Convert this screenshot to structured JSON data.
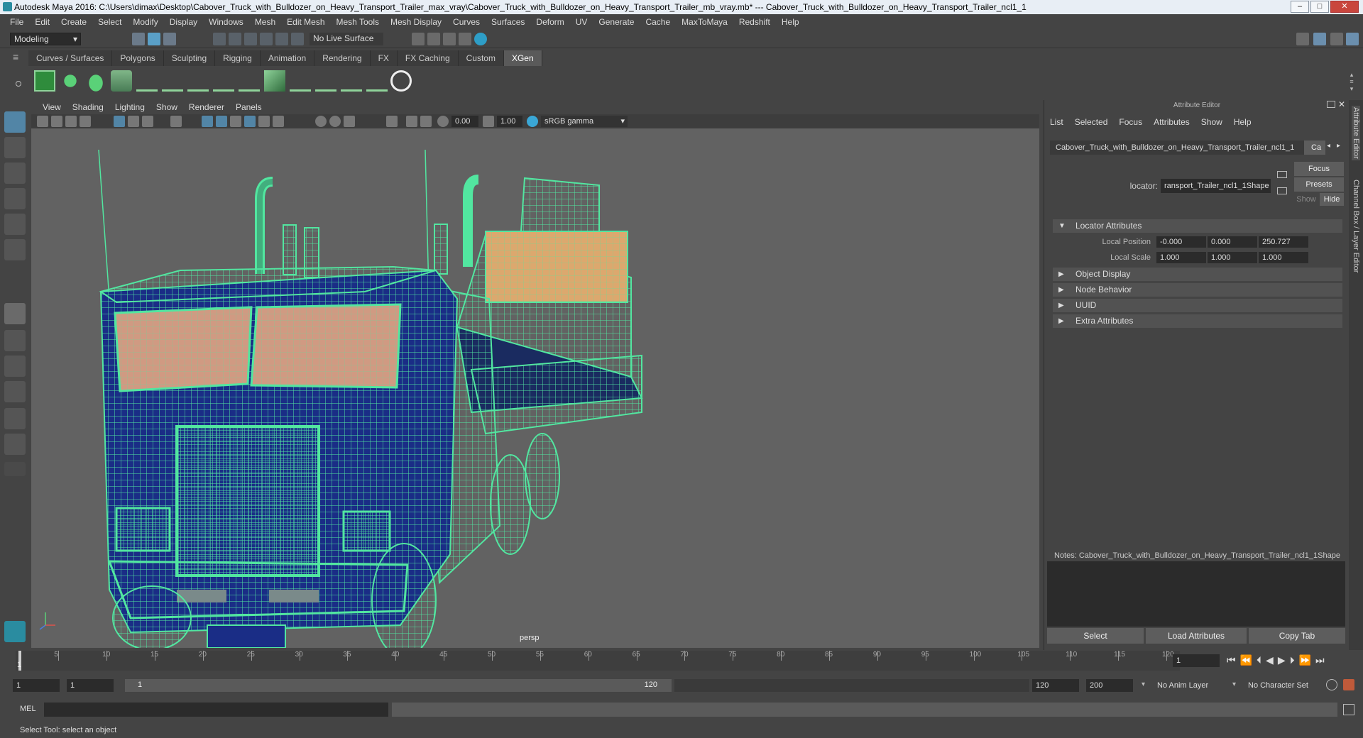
{
  "title_bar": {
    "text": "Autodesk Maya 2016: C:\\Users\\dimax\\Desktop\\Cabover_Truck_with_Bulldozer_on_Heavy_Transport_Trailer_max_vray\\Cabover_Truck_with_Bulldozer_on_Heavy_Transport_Trailer_mb_vray.mb* --- Cabover_Truck_with_Bulldozer_on_Heavy_Transport_Trailer_ncl1_1",
    "minimize": "–",
    "maximize": "□",
    "close": "✕"
  },
  "menu": [
    "File",
    "Edit",
    "Create",
    "Select",
    "Modify",
    "Display",
    "Windows",
    "Mesh",
    "Edit Mesh",
    "Mesh Tools",
    "Mesh Display",
    "Curves",
    "Surfaces",
    "Deform",
    "UV",
    "Generate",
    "Cache",
    "MaxToMaya",
    "Redshift",
    "Help"
  ],
  "status_line": {
    "mode": "Modeling",
    "live_surface": "No Live Surface"
  },
  "shelf_tabs": [
    "Curves / Surfaces",
    "Polygons",
    "Sculpting",
    "Rigging",
    "Animation",
    "Rendering",
    "FX",
    "FX Caching",
    "Custom",
    "XGen"
  ],
  "active_shelf_tab": "XGen",
  "viewport": {
    "menu": [
      "View",
      "Shading",
      "Lighting",
      "Show",
      "Renderer",
      "Panels"
    ],
    "exposure": "0.00",
    "gamma": "1.00",
    "color_space": "sRGB gamma",
    "camera_label": "persp",
    "wire_color": "#52e6a0",
    "background": "#626262"
  },
  "attribute_editor": {
    "header": "Attribute Editor",
    "menu": [
      "List",
      "Selected",
      "Focus",
      "Attributes",
      "Show",
      "Help"
    ],
    "node_tab": "Cabover_Truck_with_Bulldozer_on_Heavy_Transport_Trailer_ncl1_1",
    "node_tab_short": "Ca",
    "type_label": "locator:",
    "type_value": "ransport_Trailer_ncl1_1Shape",
    "focus_btn": "Focus",
    "presets_btn": "Presets",
    "show_btn": "Show",
    "hide_btn": "Hide",
    "sections": [
      {
        "label": "Locator Attributes",
        "expanded": true
      },
      {
        "label": "Object Display",
        "expanded": false
      },
      {
        "label": "Node Behavior",
        "expanded": false
      },
      {
        "label": "UUID",
        "expanded": false
      },
      {
        "label": "Extra Attributes",
        "expanded": false
      }
    ],
    "local_position_label": "Local Position",
    "local_position": [
      "-0.000",
      "0.000",
      "250.727"
    ],
    "local_scale_label": "Local Scale",
    "local_scale": [
      "1.000",
      "1.000",
      "1.000"
    ],
    "notes_label": "Notes:",
    "notes_value": "Cabover_Truck_with_Bulldozer_on_Heavy_Transport_Trailer_ncl1_1Shape",
    "select_btn": "Select",
    "load_btn": "Load Attributes",
    "copy_btn": "Copy Tab"
  },
  "right_strip": {
    "tab1": "Attribute Editor",
    "tab2": "Channel Box / Layer Editor"
  },
  "timeline": {
    "ticks": [
      1,
      5,
      10,
      15,
      20,
      25,
      30,
      35,
      40,
      45,
      50,
      55,
      60,
      65,
      70,
      75,
      80,
      85,
      90,
      95,
      100,
      105,
      110,
      115,
      120
    ],
    "current_frame": "1",
    "current_frame_field": "1"
  },
  "range": {
    "start": "1",
    "start_inner": "1",
    "slider_start": "1",
    "slider_end": "120",
    "end_inner": "120",
    "end": "200",
    "anim_layer": "No Anim Layer",
    "char_set": "No Character Set"
  },
  "mel_label": "MEL",
  "help_line": "Select Tool: select an object"
}
